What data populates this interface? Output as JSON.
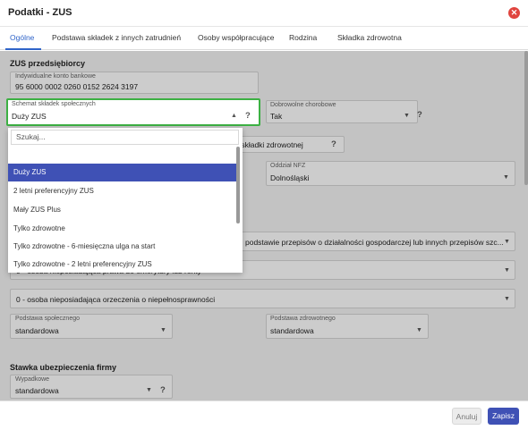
{
  "dialog": {
    "title": "Podatki - ZUS",
    "close_icon": "close-circle-icon"
  },
  "tabs": [
    {
      "label": "Ogólne",
      "active": true
    },
    {
      "label": "Podstawa składek z innych zatrudnień",
      "active": false
    },
    {
      "label": "Osoby współpracujące",
      "active": false
    },
    {
      "label": "Rodzina",
      "active": false
    },
    {
      "label": "Składka zdrowotna",
      "active": false
    }
  ],
  "zus": {
    "section_title": "ZUS przedsiębiorcy",
    "konto_label": "Indywidualne konto bankowe",
    "konto_value": "95 6000 0002 0260 0152 2624 3197",
    "schemat_label": "Schemat składek społecznych",
    "schemat_value": "Duży ZUS",
    "chorobowe_label": "Dobrowolne chorobowe",
    "chorobowe_value": "Tak",
    "zdrowotna_partial": "ze składki zdrowotnej",
    "nfz_label": "Oddział NFZ",
    "nfz_value": "Dolnośląski",
    "podstawa_przepisow_partial": "podstawie przepisów o działalności gospodarczej lub innych przepisów szc...",
    "kod_partial": "0 - osoba nieposiadająca prawa do emerytury lub renty",
    "niepelnosprawnosc_value": "0 - osoba nieposiadająca orzeczenia o niepełnosprawności",
    "podstawa_spol_label": "Podstawa społecznego",
    "podstawa_spol_value": "standardowa",
    "podstawa_zdr_label": "Podstawa zdrowotnego",
    "podstawa_zdr_value": "standardowa"
  },
  "stawka": {
    "section_title": "Stawka ubezpieczenia firmy",
    "wypadkowe_label": "Wypadkowe",
    "wypadkowe_value": "standardowa"
  },
  "dropdown": {
    "search_placeholder": "Szukaj...",
    "options": [
      "Duży ZUS",
      "2 letni preferencyjny ZUS",
      "Mały ZUS Plus",
      "Tylko zdrowotne",
      "Tylko zdrowotne - 6-miesięczna ulga na start",
      "Tylko zdrowotne - 2 letni preferencyjny ZUS"
    ],
    "selected": "Duży ZUS"
  },
  "footer": {
    "cancel_label": "Anuluj",
    "save_label": "Zapisz"
  },
  "colors": {
    "accent": "#3f51b5",
    "highlight": "#3cb043",
    "close": "#e0443e",
    "tab_active": "#2f64c9"
  },
  "glyphs": {
    "caret": "▼",
    "caret_up": "▲",
    "question": "?",
    "close": "✕"
  }
}
